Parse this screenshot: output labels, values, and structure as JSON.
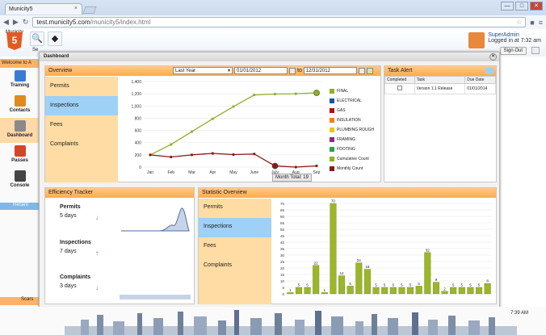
{
  "browser": {
    "tab_title": "Municity5",
    "tab_close": "×",
    "url_domain": "test.municity5.com",
    "url_path": "/municity5/index.html",
    "win_buttons": [
      "—",
      "□",
      "✕"
    ]
  },
  "header": {
    "logo_text": "Municity",
    "logo_badge": "5",
    "search_label": "Se",
    "user_name": "SuperAdmin",
    "login_info": "Logged in at 7:32 am",
    "sign_out": "Sign Out"
  },
  "sidebar": {
    "welcome": "Welcome to A",
    "items": [
      {
        "label": "Training",
        "color": "#3a7bd5"
      },
      {
        "label": "Contacts",
        "color": "#e08a1e"
      },
      {
        "label": "Dashboard",
        "color": "#8a8a8a"
      },
      {
        "label": "Passes",
        "color": "#d8432c"
      },
      {
        "label": "Console",
        "color": "#444444"
      }
    ],
    "recent": "Recent",
    "scars": "Scars"
  },
  "dashboard": {
    "title": "Dashboard",
    "close": "×",
    "overview": {
      "title": "Overview",
      "tabs": [
        "Permits",
        "Inspections",
        "Fees",
        "Complaints"
      ],
      "active_tab": 1,
      "period": "Last Year",
      "from": "01/01/2012",
      "to_label": "to",
      "to": "12/31/2012",
      "month_total": "Month Total: 19"
    },
    "task_alert": {
      "title": "Task Alert",
      "columns": [
        "Completed",
        "Task",
        "Due Date"
      ],
      "rows": [
        {
          "task": "Version 1.1 Release",
          "due": "01/01/2014"
        }
      ]
    },
    "efficiency": {
      "title": "Efficiency Tracker",
      "rows": [
        {
          "label": "Permits",
          "value": "5 days",
          "arrow": "↓",
          "color": "#5a8e1a"
        },
        {
          "label": "Inspections",
          "value": "7 days",
          "arrow": "↑",
          "color": "#c0392b"
        },
        {
          "label": "Complaints",
          "value": "3 days",
          "arrow": "↓",
          "color": "#5a8e1a"
        }
      ]
    },
    "statistic": {
      "title": "Statistic Overview",
      "tabs": [
        "Permits",
        "Inspections",
        "Fees",
        "Complaints"
      ],
      "active_tab": 1
    }
  },
  "clock": "7:39 AM",
  "chart_data": [
    {
      "type": "line",
      "title": "Overview",
      "categories": [
        "Jan",
        "Feb",
        "Mar",
        "Apr",
        "May",
        "June",
        "July",
        "Aug",
        "Sep"
      ],
      "ylim": [
        0,
        1400
      ],
      "yticks": [
        0,
        200,
        400,
        600,
        800,
        1000,
        1200,
        1400
      ],
      "series": [
        {
          "name": "Cumulative Count",
          "color": "#8fb02a",
          "values": [
            200,
            370,
            580,
            790,
            990,
            1180,
            1195,
            1200,
            1215
          ]
        },
        {
          "name": "Monthly Count",
          "color": "#8b1a1a",
          "values": [
            200,
            165,
            200,
            225,
            205,
            215,
            19,
            0,
            20
          ]
        }
      ],
      "legend": [
        {
          "name": "FINAL",
          "color": "#8fb02a"
        },
        {
          "name": "ELECTRICAL",
          "color": "#1f4fa3"
        },
        {
          "name": "GAS",
          "color": "#a3161a"
        },
        {
          "name": "INSULATION",
          "color": "#f07f1a"
        },
        {
          "name": "PLUMBING ROUGH",
          "color": "#f2c21a"
        },
        {
          "name": "FRAMING",
          "color": "#8b2a8b"
        },
        {
          "name": "FOOTING",
          "color": "#2aa34a"
        },
        {
          "name": "Cumulative Count",
          "color": "#8fb02a"
        },
        {
          "name": "Monthly Count",
          "color": "#8b1a1a"
        }
      ],
      "legend_position": "right"
    },
    {
      "type": "bar",
      "title": "Statistic Overview",
      "ylim": [
        0,
        70
      ],
      "yticks": [
        0,
        5,
        10,
        15,
        20,
        25,
        30,
        35,
        40,
        45,
        50,
        55,
        60,
        65,
        70
      ],
      "values": [
        1,
        5,
        5,
        22,
        1,
        70,
        14,
        6,
        24,
        19,
        5,
        5,
        5,
        5,
        5,
        6,
        32,
        9,
        2,
        5,
        5,
        5,
        5,
        8
      ]
    }
  ]
}
